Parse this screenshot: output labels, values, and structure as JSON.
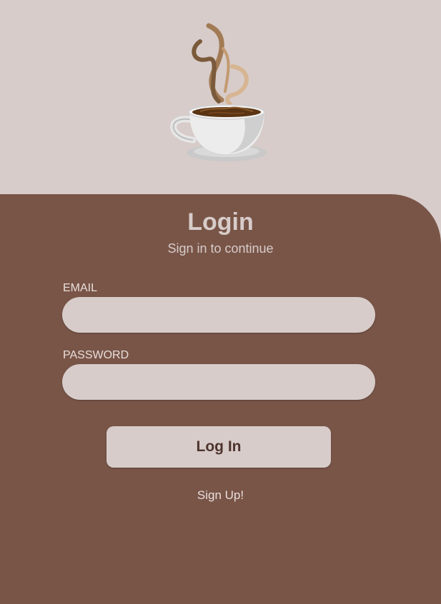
{
  "header": {
    "logo_icon": "coffee-cup-icon"
  },
  "login": {
    "title": "Login",
    "subtitle": "Sign in to continue",
    "email_label": "EMAIL",
    "email_value": "",
    "password_label": "PASSWORD",
    "password_value": "",
    "login_button": "Log In",
    "signup_link": "Sign Up!"
  },
  "colors": {
    "background": "#d7ccc9",
    "panel": "#795548",
    "text_light": "#d7ccc9",
    "button_text": "#4e342e"
  }
}
